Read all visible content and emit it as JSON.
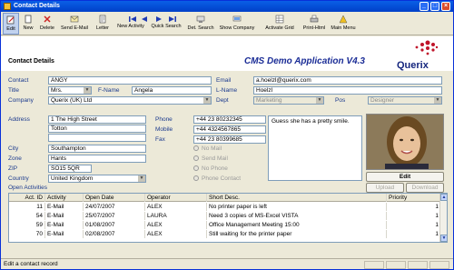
{
  "window": {
    "title": "Contact Details"
  },
  "toolbar": {
    "items": [
      {
        "label": "Edit",
        "icon": "edit-icon"
      },
      {
        "label": "New",
        "icon": "new-icon"
      },
      {
        "label": "Delete",
        "icon": "delete-icon"
      },
      {
        "label": "Send E-Mail",
        "icon": "email-icon"
      },
      {
        "label": "Letter",
        "icon": "letter-icon"
      },
      {
        "label": "New Activity",
        "icon": "new-activity-icon"
      },
      {
        "label": "Quick Search",
        "icon": "quick-search-icon"
      },
      {
        "label": "Det. Search",
        "icon": "detail-search-icon"
      },
      {
        "label": "Show Company",
        "icon": "show-company-icon"
      },
      {
        "label": "Activate Grid",
        "icon": "activate-grid-icon"
      },
      {
        "label": "Print-Html",
        "icon": "print-icon"
      },
      {
        "label": "Main Menu",
        "icon": "main-menu-icon"
      }
    ]
  },
  "header": {
    "section": "Contact Details",
    "app_title": "CMS Demo Application V4.3",
    "logo": "Querix"
  },
  "form": {
    "contact_label": "Contact",
    "contact": "ANGY",
    "title_label": "Title",
    "title": "Mrs.",
    "fname_label": "F-Name",
    "fname": "Angela",
    "company_label": "Company",
    "company": "Querix (UK) Ltd",
    "email_label": "Email",
    "email": "a.hoelzl@querix.com",
    "lname_label": "L-Name",
    "lname": "Hoelzl",
    "dept_label": "Dept",
    "dept": "Marketing",
    "pos_label": "Pos",
    "pos": "Designer",
    "address_label": "Address",
    "address1": "1 The High Street",
    "address2": "Totton",
    "address3": "",
    "city_label": "City",
    "city": "Southampton",
    "zone_label": "Zone",
    "zone": "Hants",
    "zip_label": "ZIP",
    "zip": "SO15 5QR",
    "country_label": "Country",
    "country": "United Kingdom",
    "phone_label": "Phone",
    "phone": "+44 23 80232345",
    "mobile_label": "Mobile",
    "mobile": "+44 4324567865",
    "fax_label": "Fax",
    "fax": "+44 23 80399685",
    "note": "Guess she has a pretty smile.",
    "options": [
      "No Mail",
      "Send Mail",
      "No Phone",
      "Phone Contact"
    ],
    "edit_button": "Edit",
    "upload_button": "Upload",
    "download_button": "Download"
  },
  "activities": {
    "label": "Open Activities",
    "columns": [
      "Act. ID",
      "Activity",
      "Open Date",
      "Operator",
      "Short Desc.",
      "Priority"
    ],
    "rows": [
      [
        "11",
        "E-Mail",
        "24/07/2007",
        "ALEX",
        "No printer paper is left",
        "1"
      ],
      [
        "54",
        "E-Mail",
        "25/07/2007",
        "LAURA",
        "Need 3 copies of MS-Excel VISTA",
        "1"
      ],
      [
        "59",
        "E-Mail",
        "01/08/2007",
        "ALEX",
        "Office Management Meeting 15:00",
        "1"
      ],
      [
        "70",
        "E-Mail",
        "02/08/2007",
        "ALEX",
        "Still waiting for the printer paper",
        "1"
      ]
    ]
  },
  "status": {
    "text": "Edit a contact record"
  }
}
